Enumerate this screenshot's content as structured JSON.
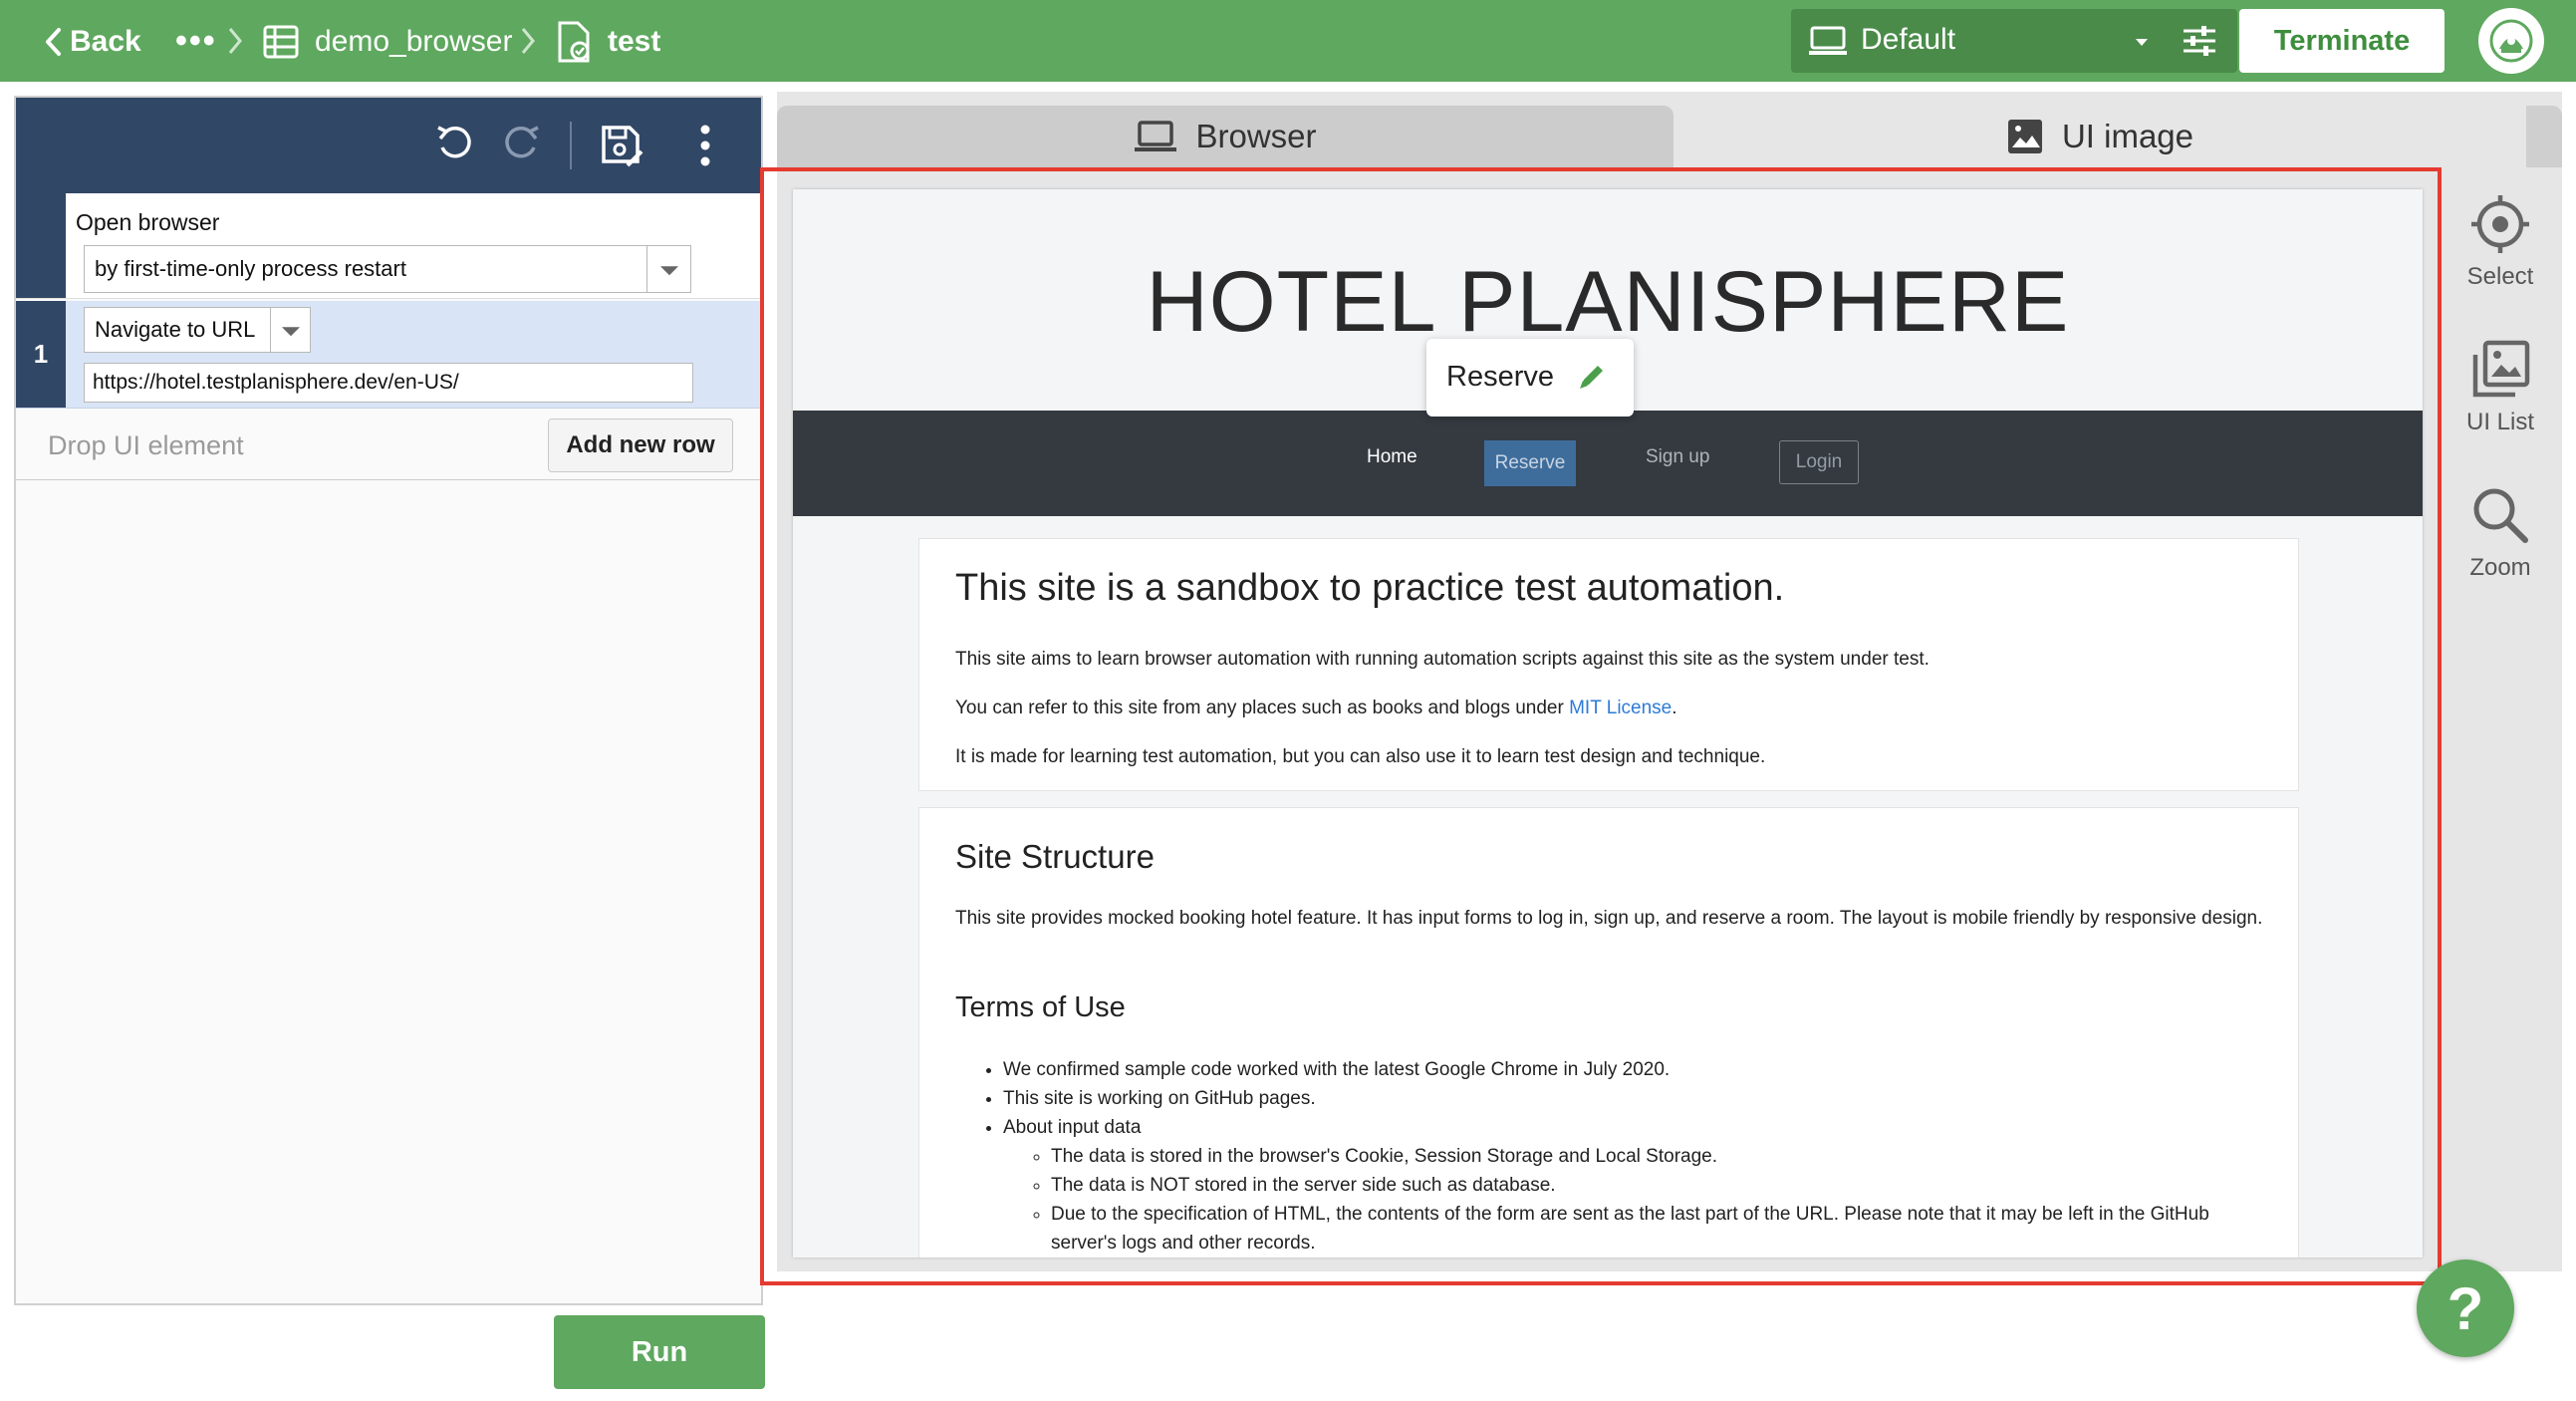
{
  "topbar": {
    "back_label": "Back",
    "ellipsis": "•••",
    "crumb_project": "demo_browser",
    "crumb_test": "test",
    "env_label": "Default",
    "terminate_label": "Terminate"
  },
  "editor": {
    "row0": {
      "title": "Open browser",
      "option": "by first-time-only process restart"
    },
    "row1": {
      "number": "1",
      "action": "Navigate to URL",
      "url": "https://hotel.testplanisphere.dev/en-US/"
    },
    "drop_placeholder": "Drop UI element",
    "add_row_label": "Add new row",
    "run_label": "Run"
  },
  "tabs": {
    "browser": "Browser",
    "ui_image": "UI image"
  },
  "side_tools": {
    "select": "Select",
    "ui_list": "UI List",
    "zoom": "Zoom"
  },
  "popover": {
    "label": "Reserve"
  },
  "hotel": {
    "title": "HOTEL PLANISPHERE",
    "nav": {
      "home": "Home",
      "reserve": "Reserve",
      "signup": "Sign up",
      "login": "Login"
    },
    "intro": {
      "heading": "This site is a sandbox to practice test automation.",
      "p1": "This site aims to learn browser automation with running automation scripts against this site as the system under test.",
      "p2_before": "You can refer to this site from any places such as books and blogs under ",
      "p2_link": "MIT License",
      "p2_after": ".",
      "p3": "It is made for learning test automation, but you can also use it to learn test design and technique."
    },
    "structure": {
      "heading": "Site Structure",
      "p1": "This site provides mocked booking hotel feature. It has input forms to log in, sign up, and reserve a room. The layout is mobile friendly by responsive design.",
      "terms_heading": "Terms of Use",
      "bullets": [
        "We confirmed sample code worked with the latest Google Chrome in July 2020.",
        "This site is working on GitHub pages.",
        "About input data"
      ],
      "sub_bullets": [
        "The data is stored in the browser's Cookie, Session Storage and Local Storage.",
        "The data is NOT stored in the server side such as database.",
        "Due to the specification of HTML, the contents of the form are sent as the last part of the URL. Please note that it may be left in the GitHub server's logs and other records."
      ]
    }
  },
  "help": {
    "label": "?"
  },
  "colors": {
    "primary_green": "#5fa85f",
    "toolbar_navy": "#314766",
    "highlight_red": "#e53b30",
    "selected_row": "#d9e5f7"
  }
}
